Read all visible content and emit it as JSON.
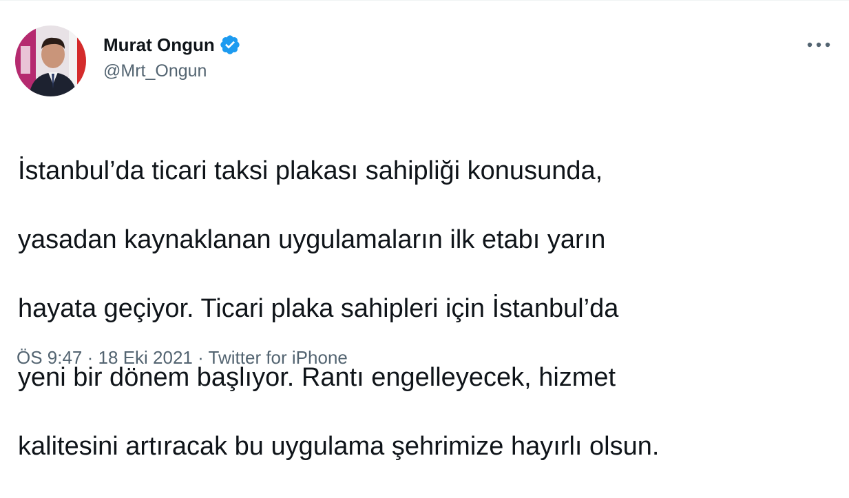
{
  "author": {
    "display_name": "Murat Ongun",
    "handle": "@Mrt_Ongun",
    "verified": true
  },
  "icons": {
    "verified": "verified-badge-icon",
    "more": "more-options-icon"
  },
  "colors": {
    "verified_badge": "#1d9bf0",
    "text_primary": "#0f1419",
    "text_secondary": "#536471"
  },
  "tweet": {
    "text_lines": [
      "İstanbul’da ticari taksi plakası sahipliği konusunda,",
      "yasadan kaynaklanan uygulamaların ilk etabı yarın",
      "hayata geçiyor. Ticari plaka sahipleri için İstanbul’da",
      "yeni bir dönem başlıyor. Rantı engelleyecek, hizmet",
      "kalitesini artıracak bu uygulama şehrimize hayırlı olsun."
    ]
  },
  "meta": {
    "time": "ÖS 9:47",
    "separator": "·",
    "date": "18 Eki 2021",
    "source": "Twitter for iPhone"
  }
}
